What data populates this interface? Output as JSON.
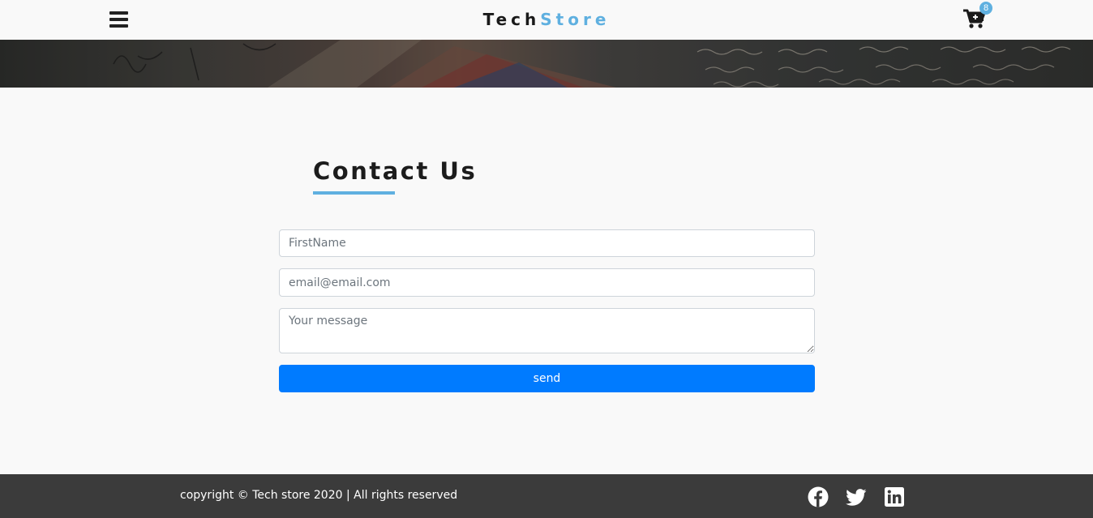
{
  "header": {
    "brand_first": "Tech",
    "brand_second": "Store",
    "cart_count": "8",
    "icons": [
      "hamburger-menu-icon",
      "cart-plus-icon"
    ]
  },
  "banner": {
    "image": "letters-and-envelopes-background"
  },
  "contact": {
    "title": "Contact Us",
    "first_name_placeholder": "FirstName",
    "email_placeholder": "email@email.com",
    "message_placeholder": "Your message",
    "send_label": "send"
  },
  "footer": {
    "copyright": "copyright © Tech store 2020 | All rights reserved",
    "social_icons": [
      "facebook-icon",
      "twitter-icon",
      "linkedin-icon"
    ]
  },
  "colors": {
    "accent": "#5fb0e0",
    "button": "#007bff",
    "footer_bg": "#3b3b3b",
    "page_bg": "#f9f9f9"
  }
}
